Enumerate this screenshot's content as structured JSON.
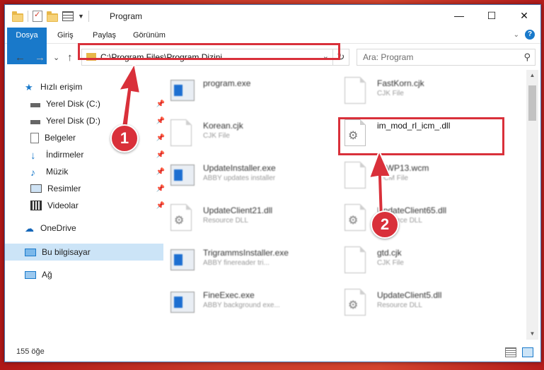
{
  "window": {
    "title": "Program",
    "controls": {
      "minimize": "—",
      "maximize": "☐",
      "close": "✕"
    }
  },
  "ribbon": {
    "tabs": [
      {
        "label": "Dosya"
      },
      {
        "label": "Giriş"
      },
      {
        "label": "Paylaş"
      },
      {
        "label": "Görünüm"
      }
    ]
  },
  "nav": {
    "back": "←",
    "forward": "→",
    "recent": "⌄",
    "up": "↑",
    "address": "C:\\Program Files\\Program Dizini",
    "search_placeholder": "Ara: Program"
  },
  "sidebar": {
    "items": [
      {
        "label": "Hızlı erişim",
        "icon": "star-icon"
      },
      {
        "label": "Yerel Disk (C:)",
        "icon": "drive-icon"
      },
      {
        "label": "Yerel Disk (D:)",
        "icon": "drive-icon"
      },
      {
        "label": "Belgeler",
        "icon": "documents-icon"
      },
      {
        "label": "İndirmeler",
        "icon": "download-icon"
      },
      {
        "label": "Müzik",
        "icon": "music-icon"
      },
      {
        "label": "Resimler",
        "icon": "pictures-icon"
      },
      {
        "label": "Videolar",
        "icon": "video-icon"
      },
      {
        "label": "OneDrive",
        "icon": "cloud-icon"
      },
      {
        "label": "Bu bilgisayar",
        "icon": "computer-icon"
      },
      {
        "label": "Ağ",
        "icon": "network-icon"
      }
    ]
  },
  "files": [
    {
      "name": "program.exe",
      "desc": "",
      "icon": "exe-icon"
    },
    {
      "name": "FastKorn.cjk",
      "desc": "CJK File",
      "icon": "file-icon"
    },
    {
      "name": "Korean.cjk",
      "desc": "CJK File",
      "icon": "file-icon"
    },
    {
      "name": "im_mod_rl_icm_.dll",
      "desc": "",
      "icon": "dll-gear-icon"
    },
    {
      "name": "UpdateInstaller.exe",
      "desc": "ABBY updates installer",
      "icon": "exe-icon"
    },
    {
      "name": "ToWP13.wcm",
      "desc": "WCM File",
      "icon": "file-icon"
    },
    {
      "name": "UpdateClient21.dll",
      "desc": "Resource DLL",
      "icon": "dll-gear-icon"
    },
    {
      "name": "UpdateClient65.dll",
      "desc": "Resource DLL",
      "icon": "dll-gear-icon"
    },
    {
      "name": "TrigrammsInstaller.exe",
      "desc": "ABBY finereader tri...",
      "icon": "exe-icon"
    },
    {
      "name": "gtd.cjk",
      "desc": "CJK File",
      "icon": "file-icon"
    },
    {
      "name": "FineExec.exe",
      "desc": "ABBY background exe...",
      "icon": "exe-icon"
    },
    {
      "name": "UpdateClient5.dll",
      "desc": "Resource DLL",
      "icon": "dll-gear-icon"
    }
  ],
  "status": {
    "count": "155 öğe"
  },
  "annotations": {
    "badge1": "1",
    "badge2": "2"
  },
  "colors": {
    "accent": "#1979ca",
    "highlight": "#d9303a",
    "selected": "#cce4f7"
  }
}
